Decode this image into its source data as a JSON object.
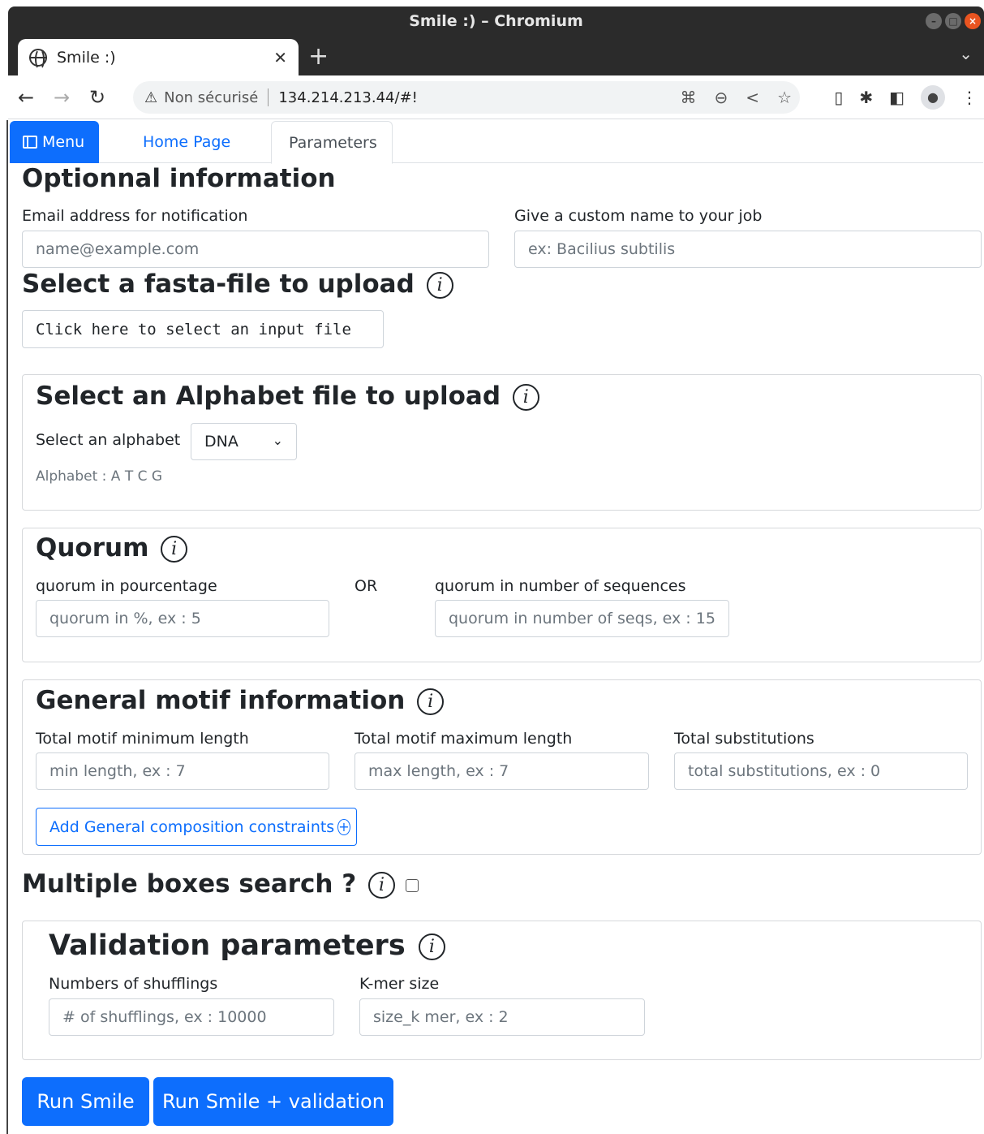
{
  "window": {
    "title": "Smile :) – Chromium"
  },
  "browser": {
    "tab_title": "Smile :)",
    "security_label": "Non sécurisé",
    "url": "134.214.213.44/#!"
  },
  "nav": {
    "menu_label": "Menu",
    "home_label": "Home Page",
    "params_label": "Parameters"
  },
  "optional": {
    "title": "Optionnal information",
    "email_label": "Email address for notification",
    "email_placeholder": "name@example.com",
    "jobname_label": "Give a custom name to your job",
    "jobname_placeholder": "ex: Bacilius subtilis"
  },
  "fasta": {
    "title": "Select a fasta-file to upload",
    "file_button": "Click here to select an input file"
  },
  "alphabet": {
    "title": "Select an Alphabet file to upload",
    "select_label": "Select an alphabet",
    "selected": "DNA",
    "help": "Alphabet : A T C G"
  },
  "quorum": {
    "title": "Quorum",
    "percent_label": "quorum in pourcentage",
    "or_label": "OR",
    "number_label": "quorum in number of sequences",
    "percent_placeholder": "quorum in %, ex : 5",
    "number_placeholder": "quorum in number of seqs, ex : 15"
  },
  "motif": {
    "title": "General motif information",
    "min_label": "Total motif minimum length",
    "max_label": "Total motif maximum length",
    "subs_label": "Total substitutions",
    "min_placeholder": "min length, ex : 7",
    "max_placeholder": "max length, ex : 7",
    "subs_placeholder": "total substitutions, ex : 0",
    "add_constraints": "Add General composition constraints"
  },
  "multiple": {
    "title": "Multiple boxes search ?"
  },
  "validation": {
    "title": "Validation parameters",
    "shuffle_label": "Numbers of shufflings",
    "kmer_label": "K-mer size",
    "shuffle_placeholder": "# of shufflings, ex : 10000",
    "kmer_placeholder": "size_k mer,  ex : 2"
  },
  "actions": {
    "run": "Run Smile",
    "run_validation": "Run Smile + validation"
  },
  "colors": {
    "primary": "#0d6efd",
    "titlebar": "#2b2b2b"
  }
}
